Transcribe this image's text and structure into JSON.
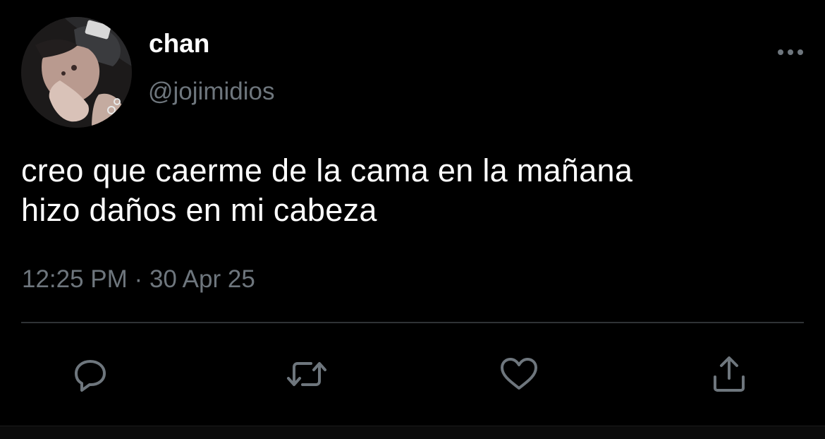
{
  "colors": {
    "background": "#000000",
    "text_primary": "#ffffff",
    "text_secondary": "#6e767d",
    "icon": "#6e767d",
    "divider": "#2f3336"
  },
  "author": {
    "display_name": "chan",
    "handle": "@jojimidios",
    "avatar_icon": "profile-photo"
  },
  "tweet": {
    "lines": [
      "creo que caerme de la cama en la mañana",
      "hizo daños en mi cabeza"
    ],
    "time": "12:25 PM",
    "separator": "·",
    "date": "30 Apr 25"
  },
  "actions": {
    "reply_icon": "reply-icon",
    "retweet_icon": "retweet-icon",
    "like_icon": "heart-icon",
    "share_icon": "share-icon",
    "more_icon": "more-options-icon"
  }
}
